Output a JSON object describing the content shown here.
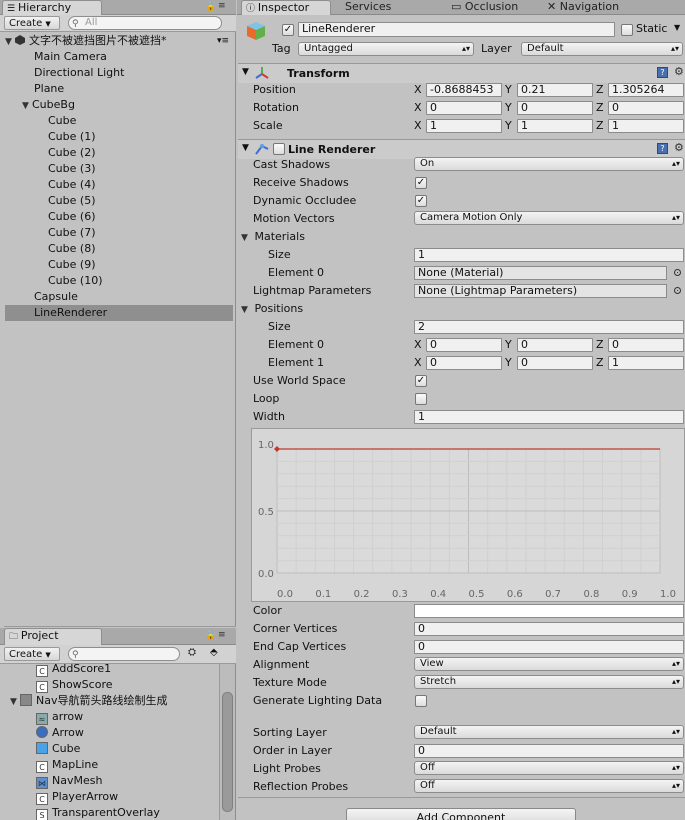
{
  "hierarchy": {
    "tab_label": "Hierarchy",
    "create_label": "Create",
    "search_placeholder": "All",
    "scene_name": "文字不被遮挡图片不被遮挡*",
    "items": [
      {
        "label": "Main Camera"
      },
      {
        "label": "Directional Light"
      },
      {
        "label": "Plane"
      },
      {
        "label": "CubeBg"
      },
      {
        "label": "Cube"
      },
      {
        "label": "Cube (1)"
      },
      {
        "label": "Cube (2)"
      },
      {
        "label": "Cube (3)"
      },
      {
        "label": "Cube (4)"
      },
      {
        "label": "Cube (5)"
      },
      {
        "label": "Cube (6)"
      },
      {
        "label": "Cube (7)"
      },
      {
        "label": "Cube (8)"
      },
      {
        "label": "Cube (9)"
      },
      {
        "label": "Cube (10)"
      },
      {
        "label": "Capsule"
      },
      {
        "label": "LineRenderer"
      }
    ]
  },
  "project": {
    "tab_label": "Project",
    "create_label": "Create",
    "items": [
      {
        "label": "AddScore1",
        "icon": "script-icon"
      },
      {
        "label": "ShowScore",
        "icon": "script-icon"
      },
      {
        "label": "Nav导航箭头路线绘制生成",
        "icon": "folder-icon"
      },
      {
        "label": "arrow",
        "icon": "mesh-icon"
      },
      {
        "label": "Arrow",
        "icon": "material-icon"
      },
      {
        "label": "Cube",
        "icon": "prefab-icon"
      },
      {
        "label": "MapLine",
        "icon": "script-icon"
      },
      {
        "label": "NavMesh",
        "icon": "navmesh-icon"
      },
      {
        "label": "PlayerArrow",
        "icon": "script-icon"
      },
      {
        "label": "TransparentOverlay",
        "icon": "shader-icon"
      }
    ]
  },
  "tabs": {
    "inspector": "Inspector",
    "services": "Services",
    "occlusion": "Occlusion",
    "navigation": "Navigation"
  },
  "object": {
    "name": "LineRenderer",
    "static_label": "Static",
    "tag_label": "Tag",
    "tag_value": "Untagged",
    "layer_label": "Layer",
    "layer_value": "Default"
  },
  "transform": {
    "title": "Transform",
    "position_label": "Position",
    "rotation_label": "Rotation",
    "scale_label": "Scale",
    "position": {
      "x": "-0.8688453",
      "y": "0.21",
      "z": "1.305264"
    },
    "rotation": {
      "x": "0",
      "y": "0",
      "z": "0"
    },
    "scale": {
      "x": "1",
      "y": "1",
      "z": "1"
    },
    "axis_x": "X",
    "axis_y": "Y",
    "axis_z": "Z"
  },
  "line_renderer": {
    "title": "Line Renderer",
    "cast_shadows_label": "Cast Shadows",
    "cast_shadows_value": "On",
    "receive_shadows_label": "Receive Shadows",
    "dynamic_occludee_label": "Dynamic Occludee",
    "motion_vectors_label": "Motion Vectors",
    "motion_vectors_value": "Camera Motion Only",
    "materials_label": "Materials",
    "size_label": "Size",
    "materials_size": "1",
    "element0_label": "Element 0",
    "element0_value": "None (Material)",
    "lightmap_label": "Lightmap Parameters",
    "lightmap_value": "None (Lightmap Parameters)",
    "positions_label": "Positions",
    "positions_size": "2",
    "pos_element1_label": "Element 1",
    "pos0": {
      "x": "0",
      "y": "0",
      "z": "0"
    },
    "pos1": {
      "x": "0",
      "y": "0",
      "z": "1"
    },
    "use_world_space_label": "Use World Space",
    "loop_label": "Loop",
    "width_label": "Width",
    "width_value": "1",
    "color_label": "Color",
    "corner_vertices_label": "Corner Vertices",
    "corner_vertices_value": "0",
    "end_cap_label": "End Cap Vertices",
    "end_cap_value": "0",
    "alignment_label": "Alignment",
    "alignment_value": "View",
    "texture_mode_label": "Texture Mode",
    "texture_mode_value": "Stretch",
    "gen_lighting_label": "Generate Lighting Data",
    "sorting_layer_label": "Sorting Layer",
    "sorting_layer_value": "Default",
    "order_in_layer_label": "Order in Layer",
    "order_in_layer_value": "0",
    "light_probes_label": "Light Probes",
    "light_probes_value": "Off",
    "reflection_probes_label": "Reflection Probes",
    "reflection_probes_value": "Off",
    "add_component_label": "Add Component",
    "check_mark": "✓"
  },
  "chart_data": {
    "type": "line",
    "x": [
      0.0,
      1.0
    ],
    "y": [
      1.0,
      1.0
    ],
    "xlim": [
      0.0,
      1.0
    ],
    "ylim": [
      0.0,
      1.0
    ],
    "x_ticks": [
      "0.0",
      "0.1",
      "0.2",
      "0.3",
      "0.4",
      "0.5",
      "0.6",
      "0.7",
      "0.8",
      "0.9",
      "1.0"
    ],
    "y_ticks": [
      "0.0",
      "0.5",
      "1.0"
    ],
    "line_color": "#c0392b",
    "grid": true
  },
  "colors": {
    "selection": "#8f8f8f",
    "panel": "#c2c2c2",
    "curve": "#c0392b"
  }
}
